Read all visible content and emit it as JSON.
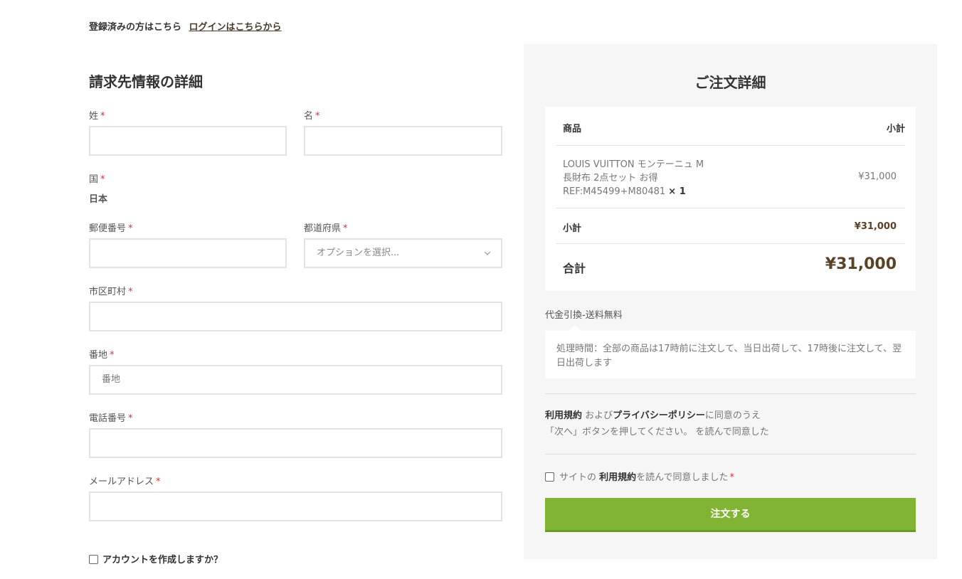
{
  "login": {
    "prompt": "登録済みの方はこちら",
    "link": "ログインはこちらから"
  },
  "billing": {
    "title": "請求先情報の詳細",
    "required_mark": "*",
    "last_name_label": "姓",
    "first_name_label": "名",
    "country_label": "国",
    "country_value": "日本",
    "postcode_label": "郵便番号",
    "state_label": "都道府県",
    "state_placeholder": "オプションを選択...",
    "city_label": "市区町村",
    "address_label": "番地",
    "address_placeholder": "番地",
    "phone_label": "電話番号",
    "email_label": "メールアドレス",
    "create_account_label": "アカウントを作成しますか？"
  },
  "order": {
    "title": "ご注文詳細",
    "col_product": "商品",
    "col_subtotal": "小計",
    "item": {
      "name_line1": "LOUIS VUITTON モンテーニュ M",
      "name_line2": "長財布 2点セット お得",
      "name_line3": "REF:M45499+M80481",
      "quantity": "× 1",
      "price": "¥31,000"
    },
    "subtotal_label": "小計",
    "subtotal_value": "¥31,000",
    "total_label": "合計",
    "total_value": "¥31,000",
    "shipping_method": "代金引換-送料無料",
    "payment_note": "処理時間：全部の商品は17時前に注文して、当日出荷して、17時後に注文して、翌日出荷します",
    "terms": {
      "terms_link": "利用規約",
      "and": "および",
      "privacy_link": "プライバシーポリシー",
      "agree_suffix": "に同意のうえ",
      "line2": "「次へ」ボタンを押してください。 を読んで同意した"
    },
    "agree": {
      "prefix": "サイトの",
      "terms_link": "利用規約",
      "suffix": "を読んで同意しました",
      "required_mark": "*"
    },
    "submit_label": "注文する"
  },
  "colors": {
    "accent_green": "#81b435",
    "required_red": "#d1333b",
    "total_brown": "#5a4226"
  }
}
